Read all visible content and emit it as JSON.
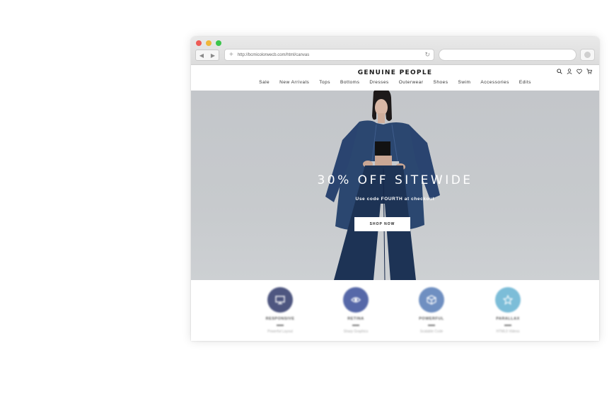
{
  "browser": {
    "url": "http://bcmicolorwecb.com/html/canvas",
    "back_glyph": "◀",
    "forward_glyph": "▶",
    "new_tab_glyph": "+",
    "reload_glyph": "↻"
  },
  "site": {
    "brand": "GENUINE PEOPLE",
    "menu": [
      "Sale",
      "New Arrivals",
      "Tops",
      "Bottoms",
      "Dresses",
      "Outerwear",
      "Shoes",
      "Swim",
      "Accessories",
      "Edits"
    ],
    "header_icons": [
      "search-icon",
      "user-icon",
      "heart-icon",
      "cart-icon"
    ]
  },
  "hero": {
    "title": "30% OFF SITEWIDE",
    "subtitle": "Use code FOURTH at checkout",
    "cta": "SHOP NOW"
  },
  "features": [
    {
      "title": "RESPONSIVE",
      "subtitle": "Powerful Layout",
      "icon": "monitor-icon",
      "color": "#4e5680"
    },
    {
      "title": "RETINA",
      "subtitle": "Sharp Graphics",
      "icon": "eye-icon",
      "color": "#5668a8"
    },
    {
      "title": "POWERFUL",
      "subtitle": "Scalable Code",
      "icon": "box-icon",
      "color": "#6f8fc1"
    },
    {
      "title": "PARALLAX",
      "subtitle": "HTML5 Videos",
      "icon": "star-icon",
      "color": "#7cbdd8"
    }
  ],
  "colors": {
    "hero_bg": "#c5c8cc",
    "denim": "#2b4770",
    "denim_dark": "#1d3355"
  }
}
